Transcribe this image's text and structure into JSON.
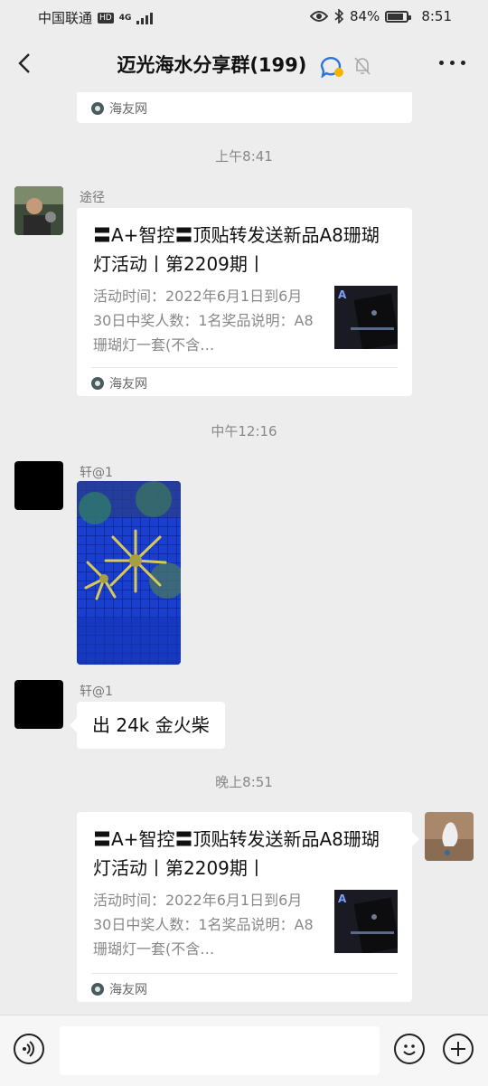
{
  "status_bar": {
    "carrier": "中国联通",
    "hd": "HD",
    "network": "4G",
    "battery_percent": "84%",
    "battery_level": 0.84,
    "time": "8:51"
  },
  "header": {
    "title": "迈光海水分享群(199)"
  },
  "messages": {
    "prev_card_source": "海友网",
    "time1": "上午8:41",
    "msg1": {
      "sender": "途径",
      "title": "〓A+智控〓顶贴转发送新品A8珊瑚灯活动丨第2209期丨",
      "desc": "活动时间：2022年6月1日到6月30日中奖人数：1名奖品说明：A8珊瑚灯一套(不含…",
      "source": "海友网",
      "thumb_text": "A"
    },
    "time2": "中午12:16",
    "msg2": {
      "sender": "轩@1"
    },
    "msg3": {
      "sender": "轩@1",
      "text": "出 24k 金火柴"
    },
    "time3": "晚上8:51",
    "msg4": {
      "title": "〓A+智控〓顶贴转发送新品A8珊瑚灯活动丨第2209期丨",
      "desc": "活动时间：2022年6月1日到6月30日中奖人数：1名奖品说明：A8珊瑚灯一套(不含…",
      "source": "海友网",
      "thumb_text": "A"
    }
  },
  "composer": {
    "placeholder": ""
  }
}
